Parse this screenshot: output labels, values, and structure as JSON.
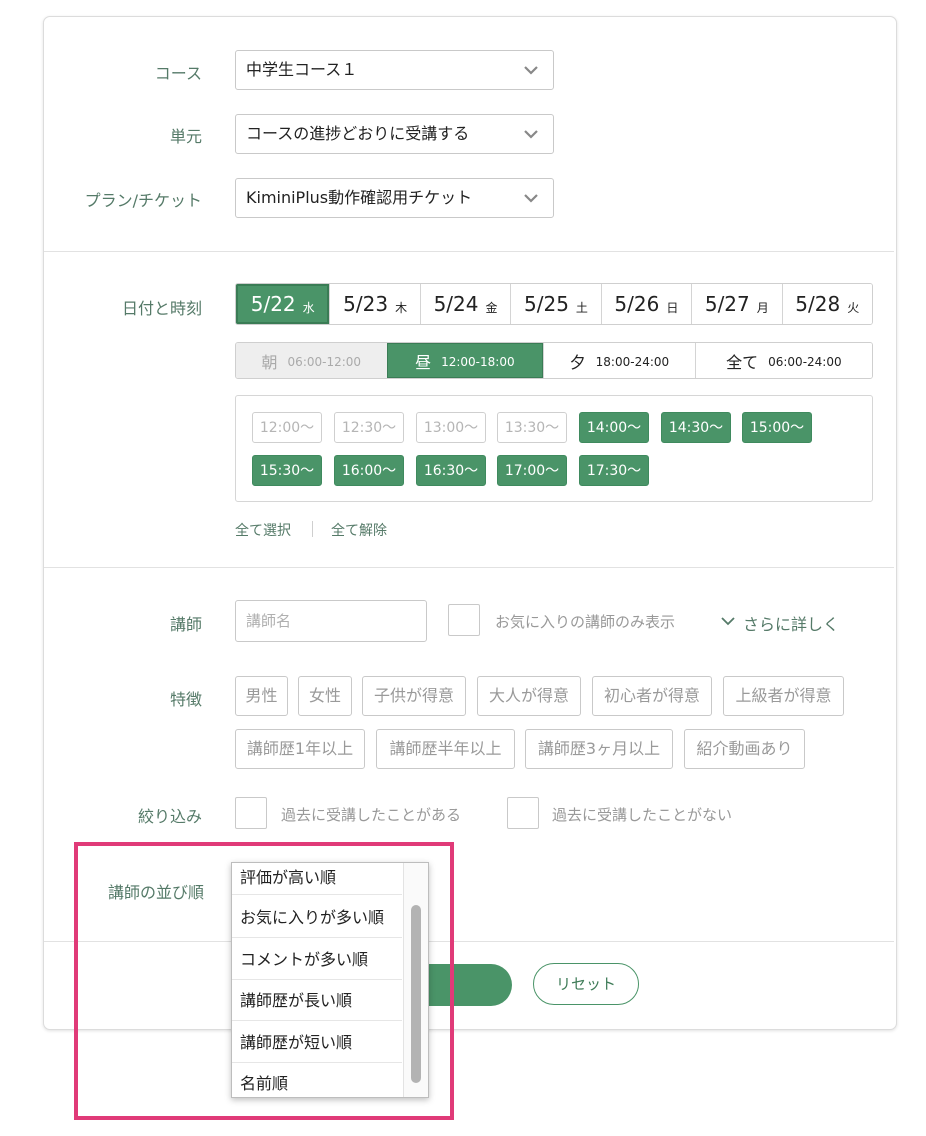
{
  "course": {
    "label": "コース",
    "value": "中学生コース１"
  },
  "unit": {
    "label": "単元",
    "value": "コースの進捗どおりに受講する"
  },
  "plan": {
    "label": "プラン/チケット",
    "value": "KiminiPlus動作確認用チケット"
  },
  "datetime": {
    "label": "日付と時刻",
    "dates": [
      {
        "date": "5/22",
        "weekday": "水",
        "selected": true
      },
      {
        "date": "5/23",
        "weekday": "木",
        "selected": false
      },
      {
        "date": "5/24",
        "weekday": "金",
        "selected": false
      },
      {
        "date": "5/25",
        "weekday": "土",
        "selected": false
      },
      {
        "date": "5/26",
        "weekday": "日",
        "selected": false
      },
      {
        "date": "5/27",
        "weekday": "月",
        "selected": false
      },
      {
        "date": "5/28",
        "weekday": "火",
        "selected": false
      }
    ],
    "periods": [
      {
        "name": "朝",
        "range": "06:00-12:00",
        "state": "disabled"
      },
      {
        "name": "昼",
        "range": "12:00-18:00",
        "state": "active"
      },
      {
        "name": "夕",
        "range": "18:00-24:00",
        "state": "normal"
      },
      {
        "name": "全て",
        "range": "06:00-24:00",
        "state": "normal"
      }
    ],
    "slots": [
      {
        "time": "12:00〜",
        "on": false
      },
      {
        "time": "12:30〜",
        "on": false
      },
      {
        "time": "13:00〜",
        "on": false
      },
      {
        "time": "13:30〜",
        "on": false
      },
      {
        "time": "14:00〜",
        "on": true
      },
      {
        "time": "14:30〜",
        "on": true
      },
      {
        "time": "15:00〜",
        "on": true
      },
      {
        "time": "15:30〜",
        "on": true
      },
      {
        "time": "16:00〜",
        "on": true
      },
      {
        "time": "16:30〜",
        "on": true
      },
      {
        "time": "17:00〜",
        "on": true
      },
      {
        "time": "17:30〜",
        "on": true
      }
    ],
    "select_all": "全て選択",
    "deselect_all": "全て解除"
  },
  "teacher": {
    "label": "講師",
    "name_placeholder": "講師名",
    "favorites_only": "お気に入りの講師のみ表示",
    "more_details": "さらに詳しく"
  },
  "features": {
    "label": "特徴",
    "tags": [
      "男性",
      "女性",
      "子供が得意",
      "大人が得意",
      "初心者が得意",
      "上級者が得意",
      "講師歴1年以上",
      "講師歴半年以上",
      "講師歴3ヶ月以上",
      "紹介動画あり"
    ]
  },
  "filter": {
    "label": "絞り込み",
    "taken_before": "過去に受講したことがある",
    "never_taken": "過去に受講したことがない"
  },
  "sort": {
    "label": "講師の並び順",
    "options": [
      "評価が高い順",
      "お気に入りが多い順",
      "コメントが多い順",
      "講師歴が長い順",
      "講師歴が短い順",
      "名前順"
    ]
  },
  "actions": {
    "reset": "リセット"
  },
  "colors": {
    "accent": "#4a9468",
    "highlight": "#e03a78",
    "label": "#557a68"
  }
}
